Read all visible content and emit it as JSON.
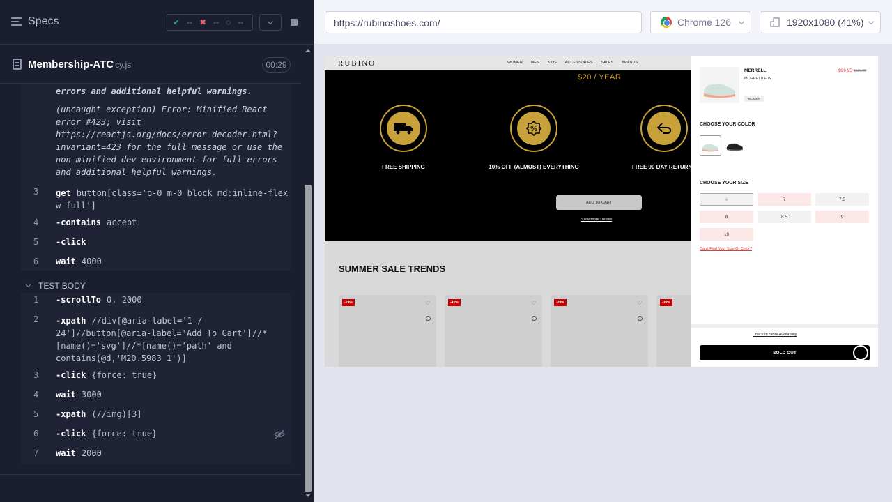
{
  "reporter": {
    "specs_label": "Specs",
    "stats": {
      "passed": "--",
      "failed": "--",
      "pending": "--"
    },
    "spec_name": "Membership-ATC",
    "spec_ext": "cy.js",
    "timer": "00:29",
    "error_tail": "errors and additional helpful warnings.",
    "error_text": "(uncaught exception)  Error: Minified React error #423; visit https://reactjs.org/docs/error-decoder.html?invariant=423 for the full message or use the non-minified dev environment for full errors and additional helpful warnings.",
    "hook_commands": [
      {
        "num": "3",
        "name": "get",
        "msg": "button[class='p-0 m-0 block md:inline-flex w-full']"
      },
      {
        "num": "4",
        "name": "-contains",
        "msg": "accept"
      },
      {
        "num": "5",
        "name": "-click",
        "msg": ""
      },
      {
        "num": "6",
        "name": "wait",
        "msg": "4000"
      }
    ],
    "test_body_label": "TEST BODY",
    "body_commands": [
      {
        "num": "1",
        "name": "-scrollTo",
        "msg": "0, 2000"
      },
      {
        "num": "2",
        "name": "-xpath",
        "msg": "//div[@aria-label='1 / 24']//button[@aria-label='Add To Cart']//*[name()='svg']//*[name()='path' and contains(@d,'M20.5983 1')]"
      },
      {
        "num": "3",
        "name": "-click",
        "msg": "{force: true}"
      },
      {
        "num": "4",
        "name": "wait",
        "msg": "3000"
      },
      {
        "num": "5",
        "name": "-xpath",
        "msg": "(//img)[3]"
      },
      {
        "num": "6",
        "name": "-click",
        "msg": "{force: true}"
      },
      {
        "num": "7",
        "name": "wait",
        "msg": "2000"
      }
    ]
  },
  "aut": {
    "url": "https://rubinoshoes.com/",
    "browser": "Chrome 126",
    "viewport": "1920x1080  (41%)"
  },
  "site": {
    "logo": "RUBINO",
    "nav": [
      "WOMEN",
      "MEN",
      "KIDS",
      "ACCESSORIES",
      "SALES",
      "BRANDS"
    ],
    "price_year": "$20 / YEAR",
    "perks": [
      "FREE SHIPPING",
      "10% OFF (ALMOST) EVERYTHING",
      "FREE 90 DAY RETURNS"
    ],
    "add_to_cart": "ADD TO CART",
    "view_more": "View More Details",
    "sale_title": "SUMMER SALE TRENDS",
    "discounts": [
      "-19%",
      "-45%",
      "-20%",
      "-30%"
    ],
    "panel": {
      "brand": "MERRELL",
      "model": "MORPHLITE W",
      "tag": "WOMEN",
      "price": "$99.95",
      "old_price": "$139.99",
      "choose_color": "CHOOSE YOUR COLOR",
      "choose_size": "CHOOSE YOUR SIZE",
      "sizes": [
        "6",
        "7",
        "7.5",
        "8",
        "8.5",
        "9",
        "10"
      ],
      "cant_find": "Can't Find Your Size Or Color?",
      "availability": "Check In Store Availability",
      "sold_out": "SOLD OUT"
    }
  }
}
